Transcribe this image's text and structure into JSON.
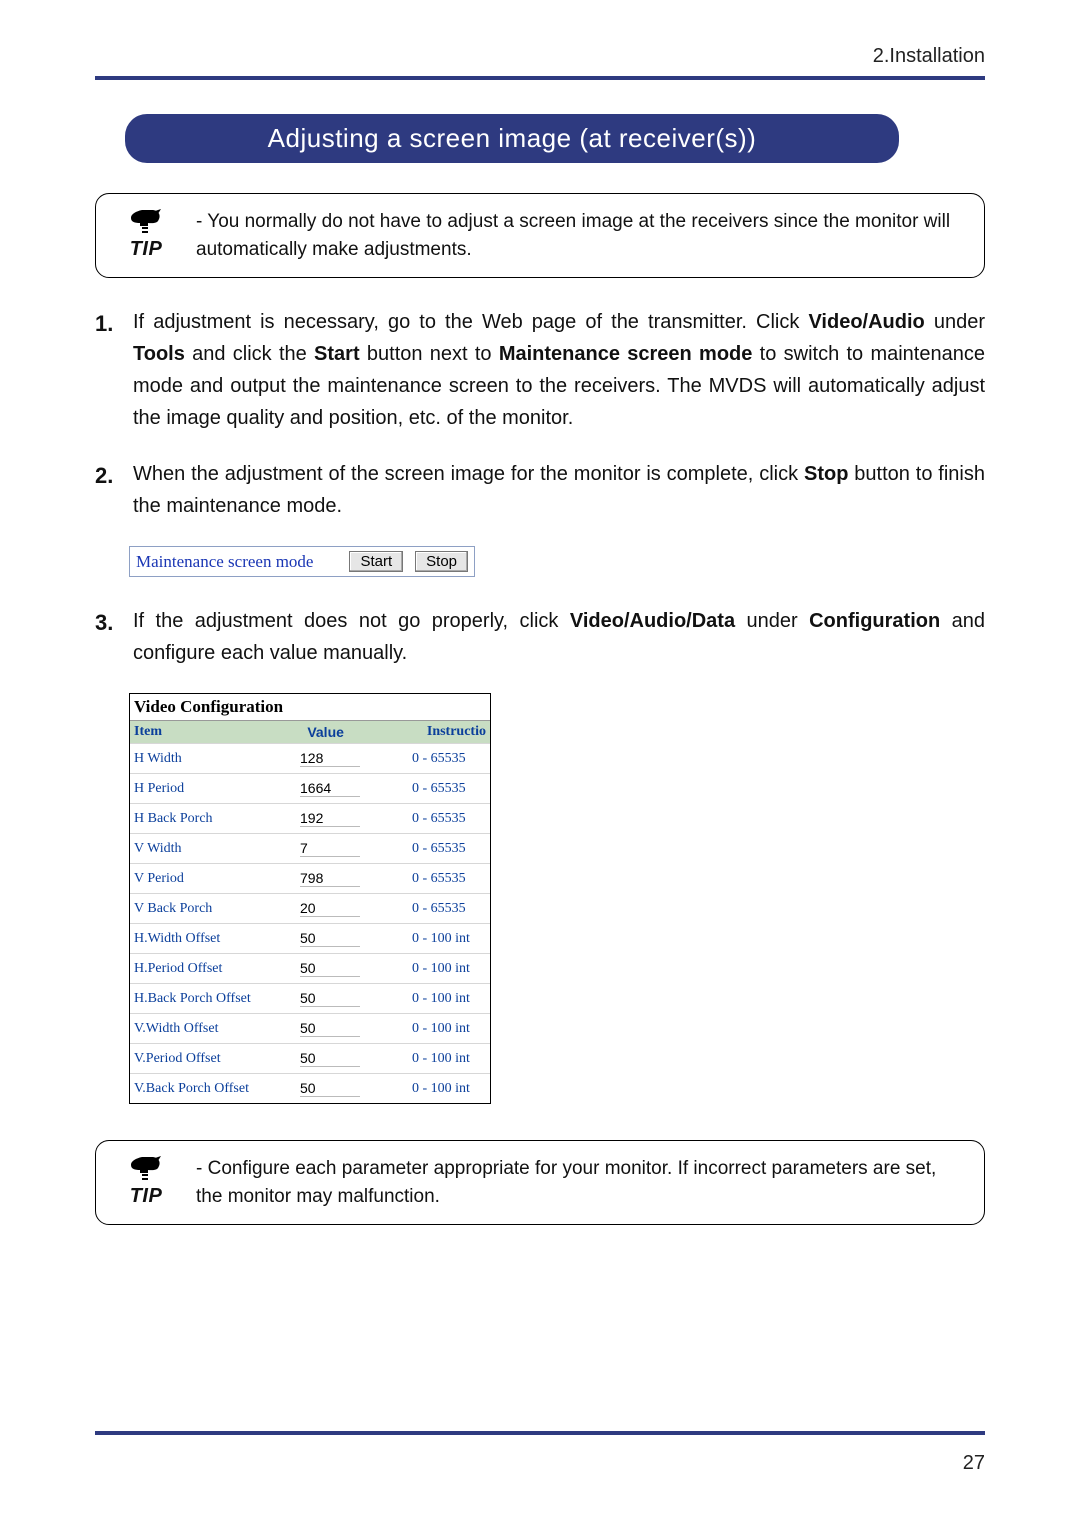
{
  "breadcrumb": "2.Installation",
  "heading": "Adjusting a screen image (at receiver(s))",
  "tip_label": "TIP",
  "tip1_text": "You normally do not have to adjust a screen image at the receivers since the monitor will automatically make adjustments.",
  "steps": [
    {
      "num": "1.",
      "html": "If adjustment is necessary, go to the Web page of the transmitter. Click <b>Video/Audio</b> under <b>Tools</b> and click the <b>Start</b> button next to <b>Maintenance screen mode</b> to switch to maintenance mode and output the maintenance screen to the receivers. The MVDS will automatically adjust the image quality and position, etc. of the monitor."
    },
    {
      "num": "2.",
      "html": "When the adjustment of the screen image for the monitor is complete, click <b>Stop</b> button to finish the maintenance mode."
    },
    {
      "num": "3.",
      "html": "If the adjustment does not go properly, click <b>Video/Audio/Data</b> under <b>Configuration</b> and configure each value manually."
    }
  ],
  "maint": {
    "label": "Maintenance screen mode",
    "start": "Start",
    "stop": "Stop"
  },
  "vc": {
    "title": "Video Configuration",
    "cols": {
      "item": "Item",
      "value": "Value",
      "instr": "Instructio"
    },
    "rows": [
      {
        "item": "H Width",
        "value": "128",
        "instr": "0 - 65535"
      },
      {
        "item": "H Period",
        "value": "1664",
        "instr": "0 - 65535"
      },
      {
        "item": "H Back Porch",
        "value": "192",
        "instr": "0 - 65535"
      },
      {
        "item": "V Width",
        "value": "7",
        "instr": "0 - 65535"
      },
      {
        "item": "V Period",
        "value": "798",
        "instr": "0 - 65535"
      },
      {
        "item": "V Back Porch",
        "value": "20",
        "instr": "0 - 65535"
      },
      {
        "item": "H.Width Offset",
        "value": "50",
        "instr": "0 - 100 int"
      },
      {
        "item": "H.Period Offset",
        "value": "50",
        "instr": "0 - 100 int"
      },
      {
        "item": "H.Back Porch Offset",
        "value": "50",
        "instr": "0 - 100 int"
      },
      {
        "item": "V.Width Offset",
        "value": "50",
        "instr": "0 - 100 int"
      },
      {
        "item": "V.Period Offset",
        "value": "50",
        "instr": "0 - 100 int"
      },
      {
        "item": "V.Back Porch Offset",
        "value": "50",
        "instr": "0 - 100 int"
      }
    ]
  },
  "tip2_text": "Configure each parameter appropriate for your monitor. If incorrect parameters are set, the monitor may malfunction.",
  "page_number": "27"
}
